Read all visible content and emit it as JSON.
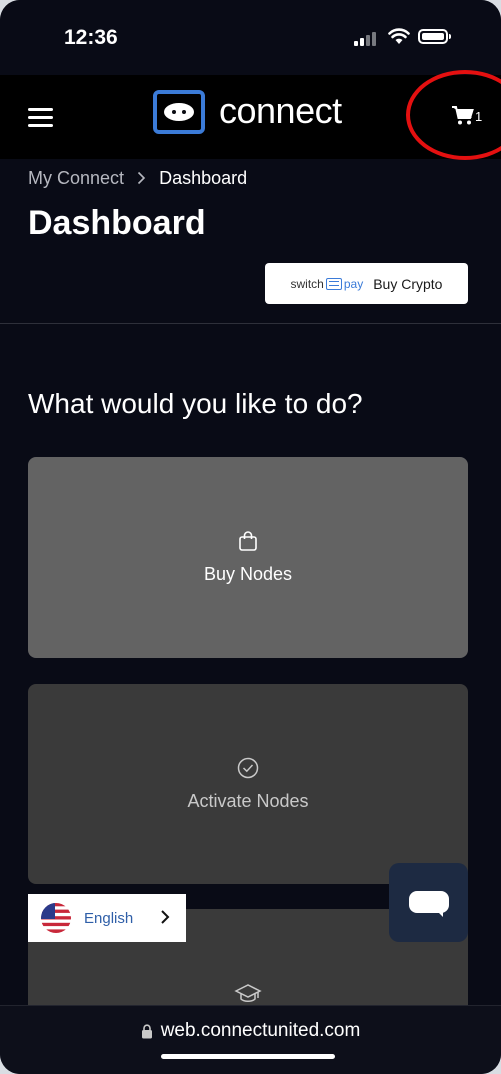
{
  "status_bar": {
    "time": "12:36"
  },
  "header": {
    "logo_text": "connect",
    "cart_count": "1"
  },
  "breadcrumb": {
    "parent": "My Connect",
    "current": "Dashboard"
  },
  "page": {
    "title": "Dashboard",
    "question": "What would you like to do?"
  },
  "buy_crypto": {
    "brand_left": "switch",
    "brand_right": "pay",
    "label": "Buy Crypto"
  },
  "actions": [
    {
      "label": "Buy Nodes",
      "icon": "shopping-bag-icon"
    },
    {
      "label": "Activate Nodes",
      "icon": "check-circle-icon"
    },
    {
      "label": "",
      "icon": "graduation-cap-icon"
    }
  ],
  "language": {
    "selected": "English",
    "flag": "us-flag-icon"
  },
  "url_bar": {
    "url": "web.connectunited.com"
  },
  "colors": {
    "accent": "#3b7bd8",
    "highlight": "#e41010",
    "background": "#090b16"
  }
}
